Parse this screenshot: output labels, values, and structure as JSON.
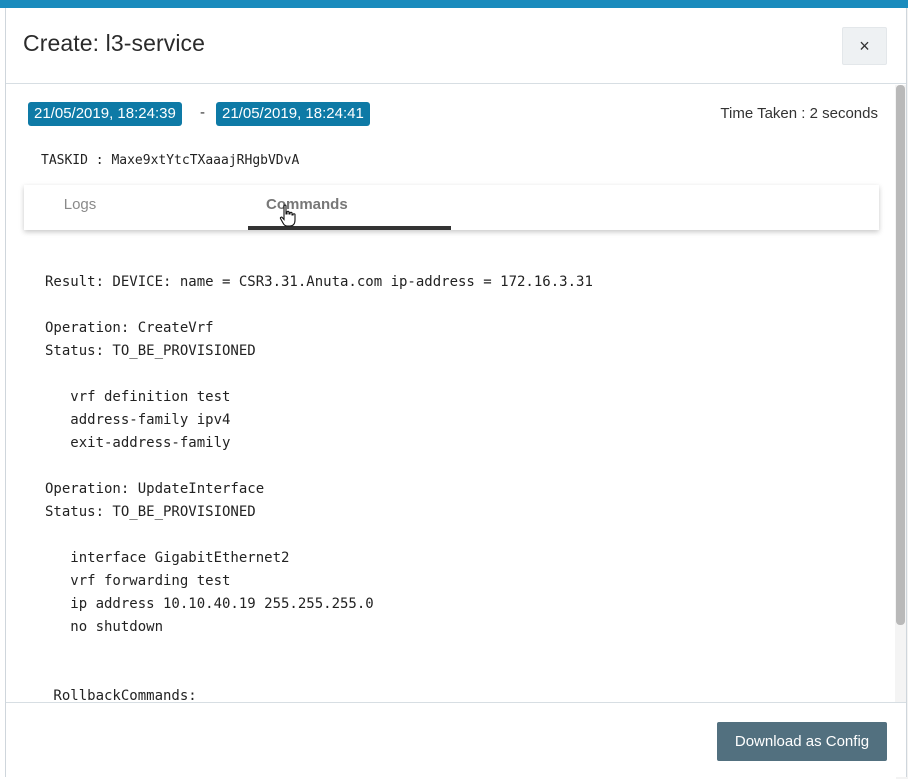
{
  "modal": {
    "title": "Create: l3-service",
    "close_label": "×"
  },
  "header_info": {
    "start_time": "21/05/2019, 18:24:39",
    "separator": "-",
    "end_time": "21/05/2019, 18:24:41",
    "time_taken": "Time Taken : 2 seconds",
    "taskid": "TASKID : Maxe9xtYtcTXaaajRHgbVDvA"
  },
  "tabs": [
    {
      "label": "Logs",
      "active": false
    },
    {
      "label": "Commands",
      "active": true
    }
  ],
  "commands": {
    "lines": [
      "Result: DEVICE: name = CSR3.31.Anuta.com ip-address = 172.16.3.31",
      "",
      "Operation: CreateVrf",
      "Status: TO_BE_PROVISIONED",
      "",
      "   vrf definition test",
      "   address-family ipv4",
      "   exit-address-family",
      "",
      "Operation: UpdateInterface",
      "Status: TO_BE_PROVISIONED",
      "",
      "   interface GigabitEthernet2",
      "   vrf forwarding test",
      "   ip address 10.10.40.19 255.255.255.0",
      "   no shutdown",
      "",
      "",
      " RollbackCommands:"
    ]
  },
  "footer": {
    "download_label": "Download as Config"
  },
  "colors": {
    "accent_strip": "#1a8bbd",
    "date_badge": "#0e7aa6",
    "download_button": "#52707f",
    "tab_underline": "#333333"
  },
  "icons": {
    "close": "close-icon",
    "cursor": "hand-pointer-icon"
  }
}
